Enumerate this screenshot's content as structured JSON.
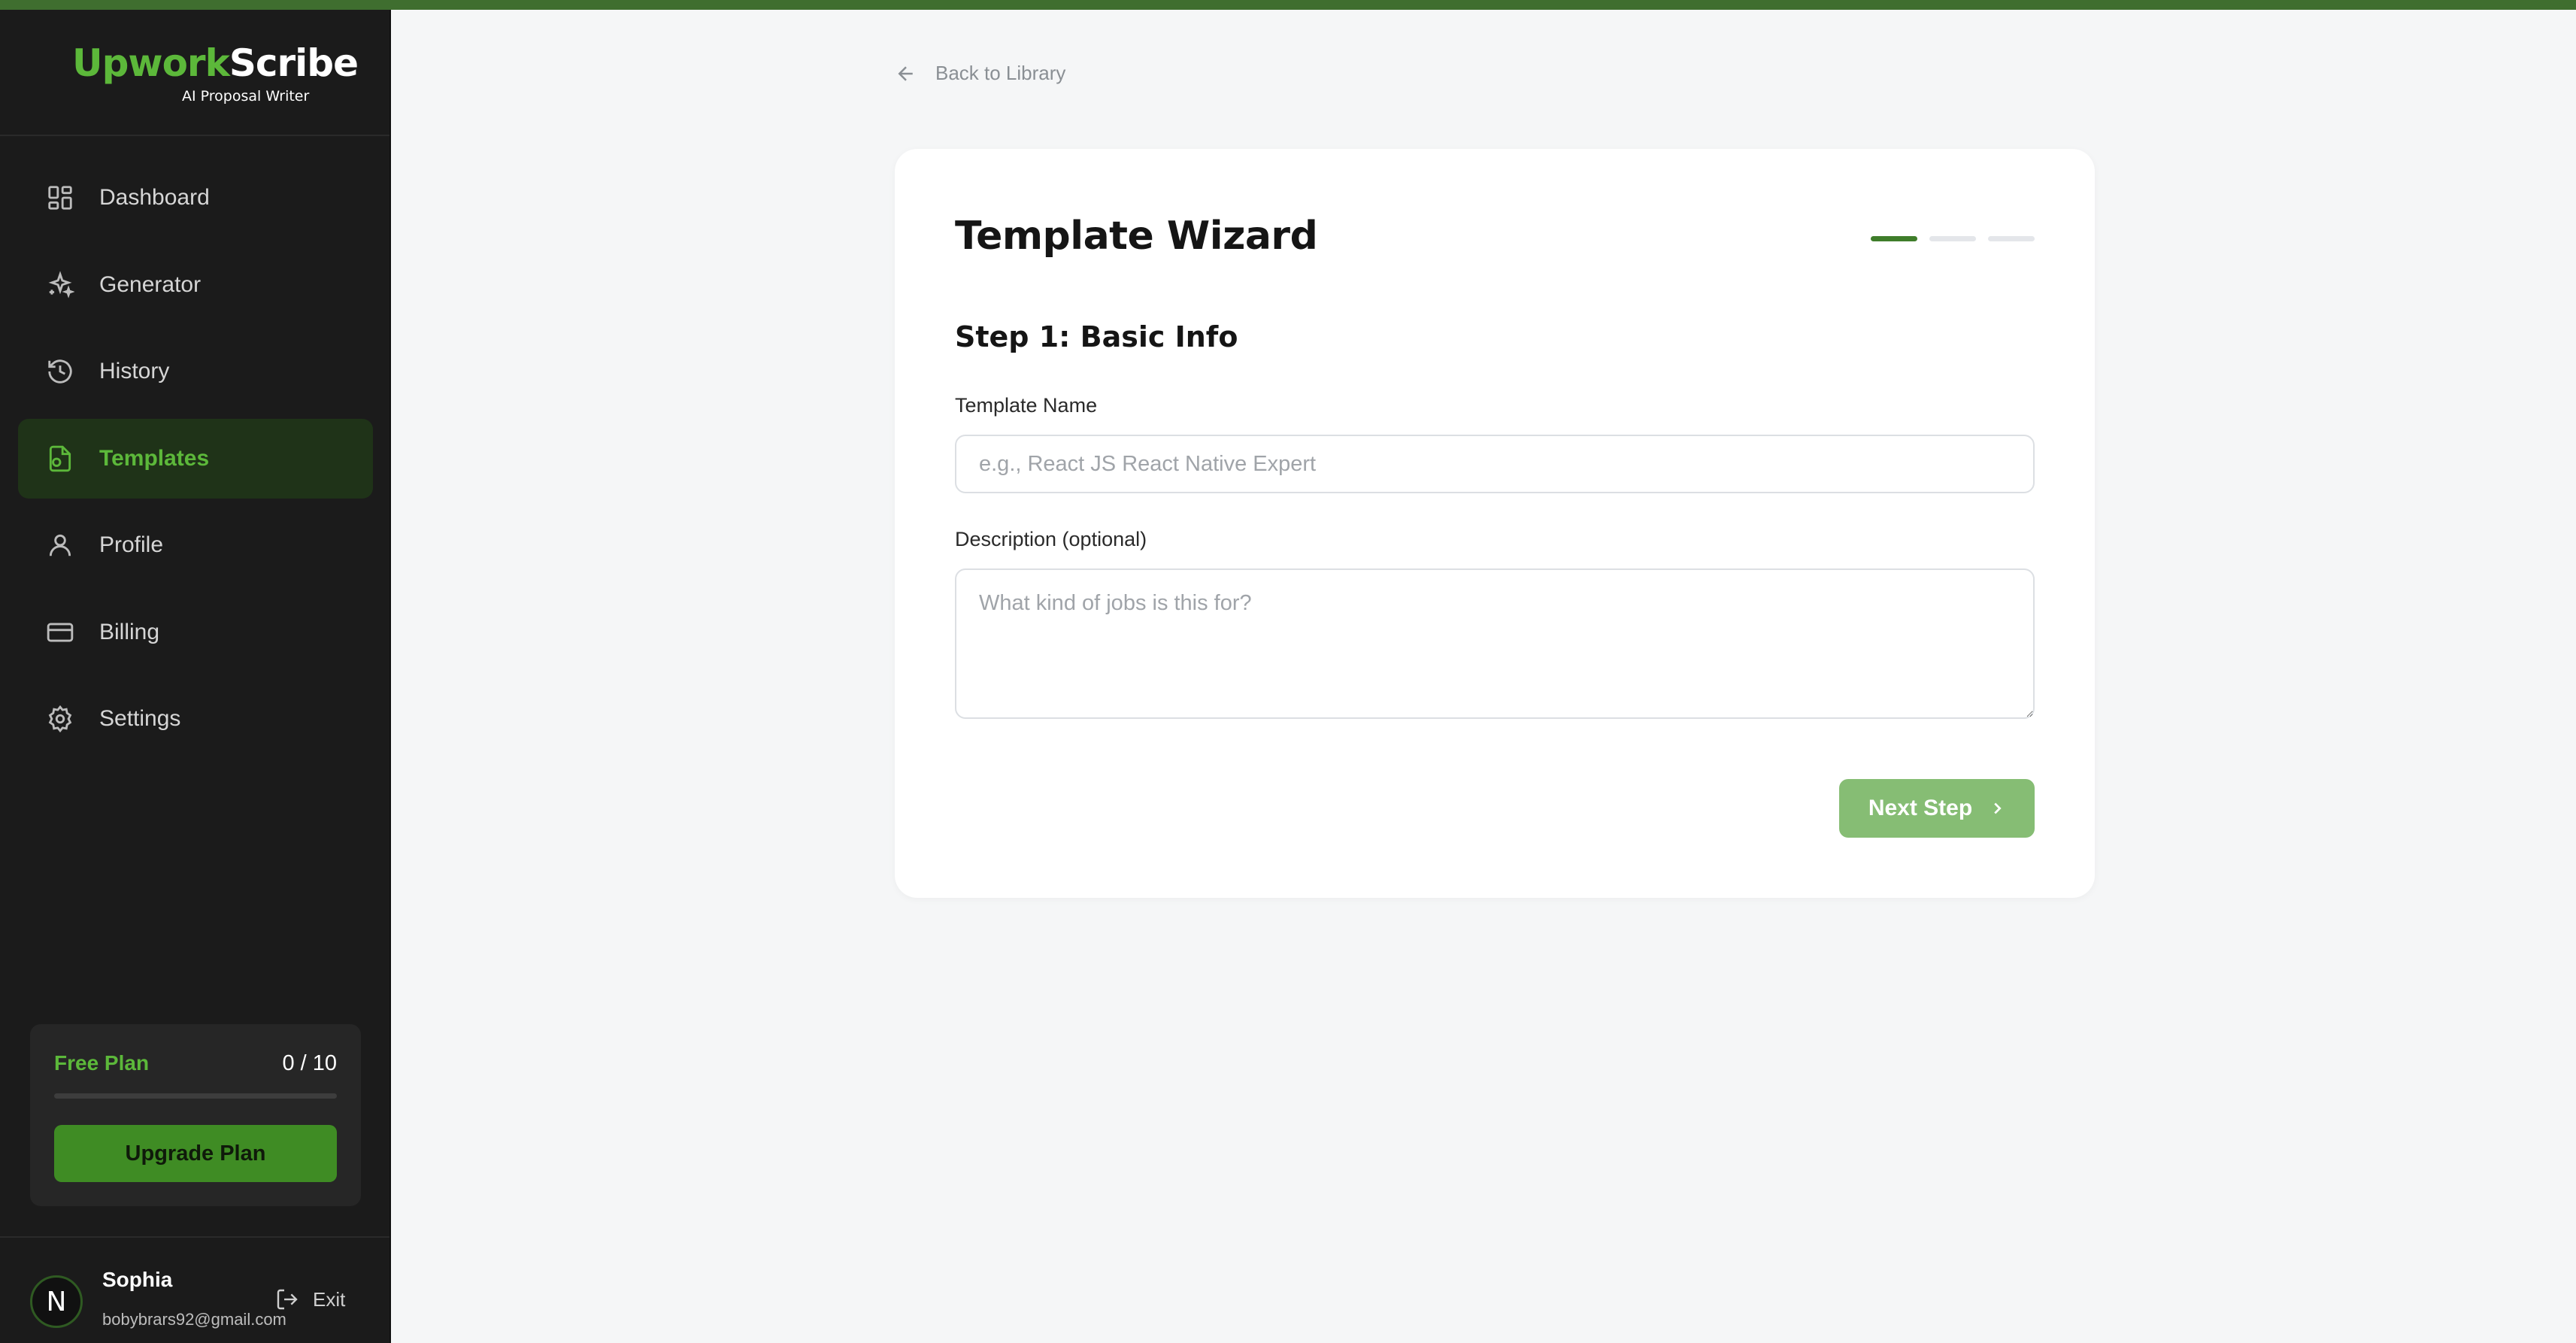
{
  "brand": {
    "name_part1": "Upwork",
    "name_part2": "Scribe",
    "tagline": "AI Proposal Writer"
  },
  "sidebar": {
    "items": [
      {
        "label": "Dashboard",
        "icon": "dashboard-icon",
        "active": false
      },
      {
        "label": "Generator",
        "icon": "sparkles-icon",
        "active": false
      },
      {
        "label": "History",
        "icon": "history-icon",
        "active": false
      },
      {
        "label": "Templates",
        "icon": "template-file-icon",
        "active": true
      },
      {
        "label": "Profile",
        "icon": "user-icon",
        "active": false
      },
      {
        "label": "Billing",
        "icon": "credit-card-icon",
        "active": false
      },
      {
        "label": "Settings",
        "icon": "gear-icon",
        "active": false
      }
    ]
  },
  "plan": {
    "name": "Free Plan",
    "usage": "0 / 10",
    "usage_fraction": 0,
    "upgrade_label": "Upgrade Plan"
  },
  "user": {
    "avatar_initial": "N",
    "name": "Sophia",
    "email": "bobybrars92@gmail.com",
    "exit_label": "Exit"
  },
  "main": {
    "back_label": "Back to Library",
    "title": "Template Wizard",
    "step_title": "Step 1: Basic Info",
    "steps": {
      "total": 3,
      "current": 1
    },
    "fields": {
      "name_label": "Template Name",
      "name_placeholder": "e.g., React JS React Native Expert",
      "name_value": "",
      "description_label": "Description (optional)",
      "description_placeholder": "What kind of jobs is this for?",
      "description_value": ""
    },
    "next_label": "Next Step"
  },
  "colors": {
    "accent": "#5cb83a",
    "topbar": "#3f6e2f",
    "sidebar_bg": "#1b1b1b",
    "next_button": "#86bd74"
  }
}
